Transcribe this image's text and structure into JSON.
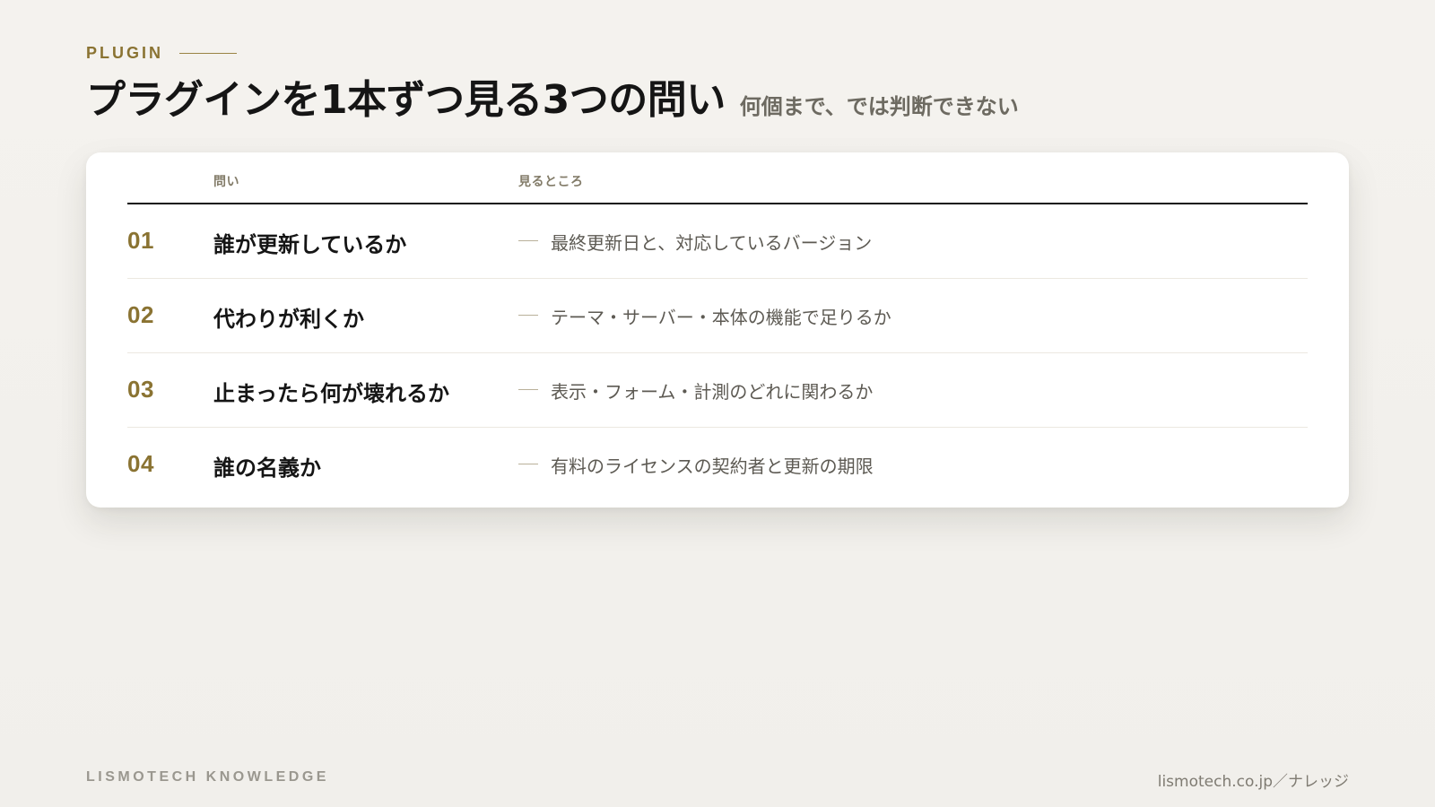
{
  "header": {
    "eyebrow": "PLUGIN",
    "title": "プラグインを1本ずつ見る3つの問い",
    "subtitle": "何個まで、では判断できない"
  },
  "table": {
    "columns": {
      "question": "問い",
      "where": "見るところ"
    },
    "rows": [
      {
        "num": "01",
        "question": "誰が更新しているか",
        "answer": "最終更新日と、対応しているバージョン"
      },
      {
        "num": "02",
        "question": "代わりが利くか",
        "answer": "テーマ・サーバー・本体の機能で足りるか"
      },
      {
        "num": "03",
        "question": "止まったら何が壊れるか",
        "answer": "表示・フォーム・計測のどれに関わるか"
      },
      {
        "num": "04",
        "question": "誰の名義か",
        "answer": "有料のライセンスの契約者と更新の期限"
      }
    ]
  },
  "footer": {
    "brand": "LISMOTECH KNOWLEDGE",
    "site": "lismotech.co.jp／ナレッジ"
  }
}
